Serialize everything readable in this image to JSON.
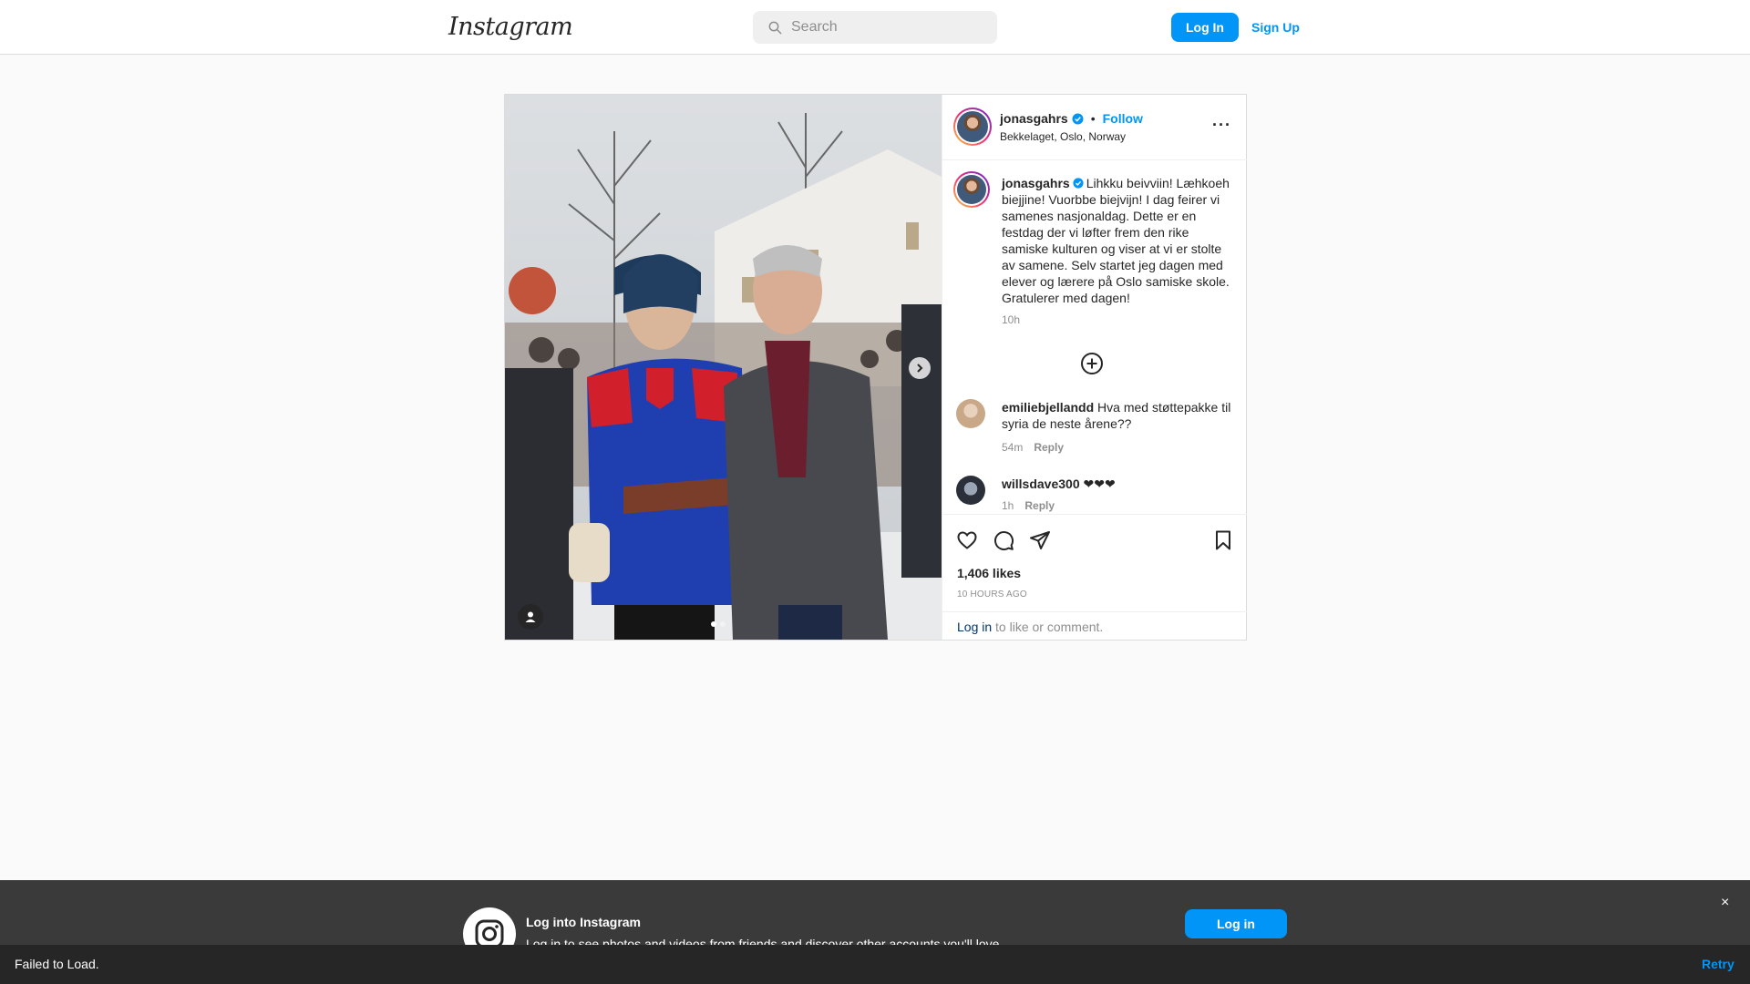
{
  "nav": {
    "logo": "Instagram",
    "search_placeholder": "Search",
    "login_label": "Log In",
    "signup_label": "Sign Up"
  },
  "post": {
    "username": "jonasgahrs",
    "follow_label": "Follow",
    "location": "Bekkelaget, Oslo, Norway",
    "caption": "Lihkku beivviin! Læhkoeh biejjine! Vuorbbe biejvijn! I dag feirer vi samenes nasjonaldag. Dette er en festdag der vi løfter frem den rike samiske kulturen og viser at vi er stolte av samene. Selv startet jeg dagen med elever og lærere på Oslo samiske skole. Gratulerer med dagen!",
    "caption_time": "10h",
    "carousel_position": 1,
    "carousel_total": 2,
    "comments": [
      {
        "username": "emiliebjellandd",
        "text": "Hva med støttepakke til syria de neste årene??",
        "time": "54m",
        "reply": "Reply"
      },
      {
        "username": "willsdave300",
        "text": "❤❤❤",
        "time": "1h",
        "reply": "Reply"
      }
    ],
    "likes": "1,406 likes",
    "time_ago": "10 HOURS AGO",
    "login_link": "Log in",
    "login_suffix": " to like or comment."
  },
  "banner": {
    "title": "Log into Instagram",
    "subtitle": "Log in to see photos and videos from friends and discover other accounts you'll love.",
    "login_label": "Log in",
    "close": "×"
  },
  "toast": {
    "message": "Failed to Load.",
    "retry": "Retry"
  },
  "colors": {
    "accent": "#0095f6",
    "verified": "#0095f6",
    "link_dark": "#00376b"
  }
}
